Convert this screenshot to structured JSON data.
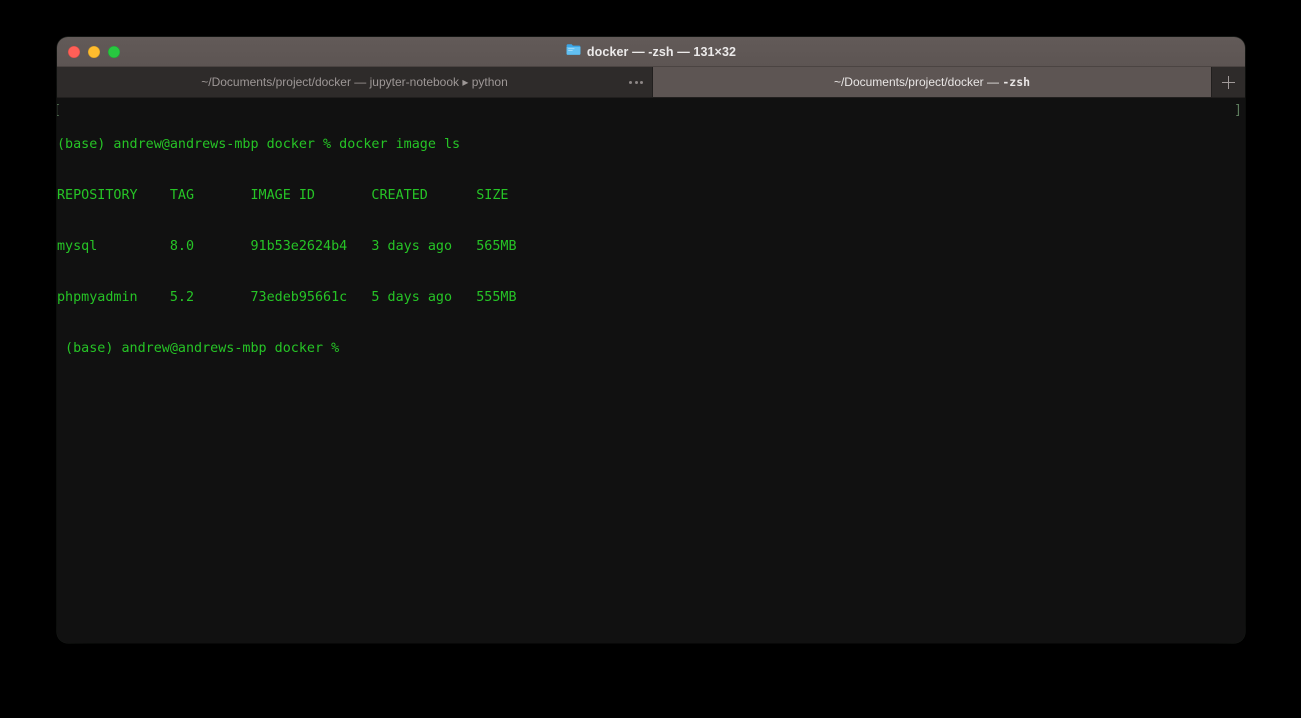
{
  "window": {
    "title": "docker — -zsh — 131×32",
    "folder_icon": "folder-icon",
    "traffic_lights": [
      {
        "name": "close-button",
        "color": "#ff5f57"
      },
      {
        "name": "minimize-button",
        "color": "#febc2e"
      },
      {
        "name": "maximize-button",
        "color": "#28c840"
      }
    ]
  },
  "tabs": [
    {
      "label": "~/Documents/project/docker — jupyter-notebook ▸ python",
      "active": false,
      "overflow_icon": "ellipsis-icon"
    },
    {
      "label_prefix": "~/Documents/project/docker — ",
      "shell": "-zsh",
      "active": true
    }
  ],
  "new_tab": {
    "icon": "plus-icon",
    "label": "+"
  },
  "terminal": {
    "colors": {
      "background": "#111111",
      "foreground": "#26c426",
      "dim": "#4e6b4e"
    },
    "left_edge_glyph": "[",
    "right_cursor_glyph": "]",
    "lines": [
      "(base) andrew@andrews-mbp docker % docker image ls",
      "REPOSITORY    TAG       IMAGE ID       CREATED      SIZE",
      "mysql         8.0       91b53e2624b4   3 days ago   565MB",
      "phpmyadmin    5.2       73edeb95661c   5 days ago   555MB",
      " (base) andrew@andrews-mbp docker % "
    ],
    "command": "docker image ls",
    "prompt": "(base) andrew@andrews-mbp docker %",
    "table": {
      "headers": [
        "REPOSITORY",
        "TAG",
        "IMAGE ID",
        "CREATED",
        "SIZE"
      ],
      "rows": [
        [
          "mysql",
          "8.0",
          "91b53e2624b4",
          "3 days ago",
          "565MB"
        ],
        [
          "phpmyadmin",
          "5.2",
          "73edeb95661c",
          "5 days ago",
          "555MB"
        ]
      ]
    }
  }
}
